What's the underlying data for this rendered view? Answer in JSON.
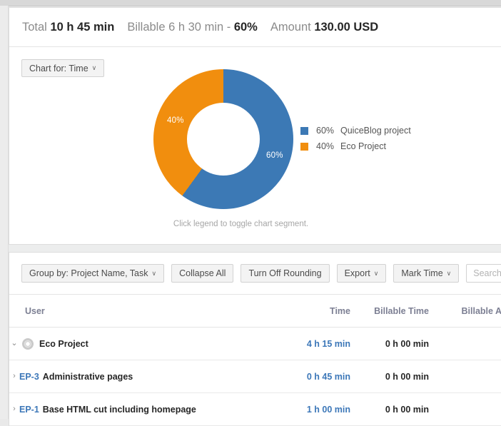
{
  "summary": {
    "total_label": "Total",
    "total_value": "10 h 45 min",
    "billable_label": "Billable 6 h 30 min - ",
    "billable_pct": "60%",
    "amount_label": "Amount",
    "amount_value": "130.00 USD"
  },
  "chart_panel": {
    "chart_for_button": "Chart for: Time",
    "caret": "∨",
    "hint": "Click legend to toggle chart segment."
  },
  "chart_data": {
    "type": "pie",
    "variant": "donut",
    "title": "",
    "categories": [
      "QuiceBlog project",
      "Eco Project"
    ],
    "values": [
      60,
      40
    ],
    "value_labels": [
      "60%",
      "40%"
    ],
    "colors": [
      "#3c79b5",
      "#f18e0e"
    ],
    "legend": {
      "position": "right",
      "entries": [
        {
          "pct": "60%",
          "name": "QuiceBlog project",
          "color": "#3c79b5"
        },
        {
          "pct": "40%",
          "name": "Eco Project",
          "color": "#f18e0e"
        }
      ]
    },
    "start_angle_deg": 0,
    "direction": "clockwise",
    "inner_radius_ratio": 0.52
  },
  "toolbar": {
    "group_by": "Group by: Project Name, Task",
    "collapse_all": "Collapse All",
    "turn_off_rounding": "Turn Off Rounding",
    "export": "Export",
    "mark_time": "Mark Time",
    "search_placeholder": "Search...",
    "search_value": "",
    "caret": "∨"
  },
  "table": {
    "headers": {
      "user": "User",
      "time": "Time",
      "billable_time": "Billable Time",
      "billable_amount": "Billable A"
    },
    "rows": [
      {
        "level": 1,
        "twisty": "⌄",
        "type": "project",
        "name": "Eco Project",
        "time": "4 h 15 min",
        "billable_time": "0 h 00 min"
      },
      {
        "level": 2,
        "twisty": "›",
        "type": "task",
        "key": "EP-3",
        "name": "Administrative pages",
        "time": "0 h 45 min",
        "billable_time": "0 h 00 min"
      },
      {
        "level": 2,
        "twisty": "›",
        "type": "task",
        "key": "EP-1",
        "name": "Base HTML cut including homepage",
        "time": "1 h 00 min",
        "billable_time": "0 h 00 min"
      }
    ]
  }
}
